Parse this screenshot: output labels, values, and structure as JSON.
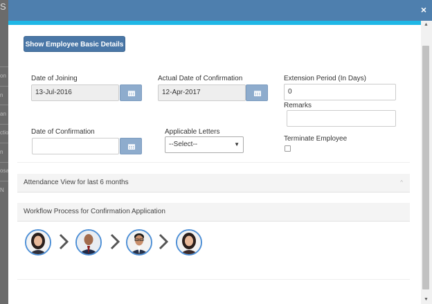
{
  "background": {
    "letter": "S",
    "fragments": [
      "on",
      "n",
      "an",
      "ctio",
      "n",
      "osa",
      "N"
    ]
  },
  "modal": {
    "close_glyph": "×",
    "show_details_button": "Show Employee Basic Details",
    "fields": {
      "date_of_joining": {
        "label": "Date of Joining",
        "value": "13-Jul-2016"
      },
      "actual_date_of_confirmation": {
        "label": "Actual Date of Confirmation",
        "value": "12-Apr-2017"
      },
      "extension_period": {
        "label": "Extension Period (In Days)",
        "value": "0"
      },
      "remarks": {
        "label": "Remarks",
        "value": ""
      },
      "date_of_confirmation": {
        "label": "Date of Confirmation",
        "value": ""
      },
      "applicable_letters": {
        "label": "Applicable Letters",
        "selected": "--Select--"
      },
      "terminate_employee": {
        "label": "Terminate Employee",
        "checked": false
      }
    },
    "attendance_panel": {
      "title": "Attendance View for last 6 months",
      "chevron": "^"
    },
    "workflow_panel": {
      "title": "Workflow Process for Confirmation Application",
      "approvers": [
        {
          "icon": "avatar-woman-icon"
        },
        {
          "icon": "avatar-man-bald-icon"
        },
        {
          "icon": "avatar-man-glasses-icon"
        },
        {
          "icon": "avatar-woman-icon"
        }
      ],
      "arrow_icon": "chevron-right-icon"
    }
  },
  "colors": {
    "header": "#4e7fae",
    "accent": "#1fb7e6",
    "button": "#4a77a7",
    "calendar_button": "#8eaccd",
    "avatar_ring": "#4d8fd6"
  }
}
